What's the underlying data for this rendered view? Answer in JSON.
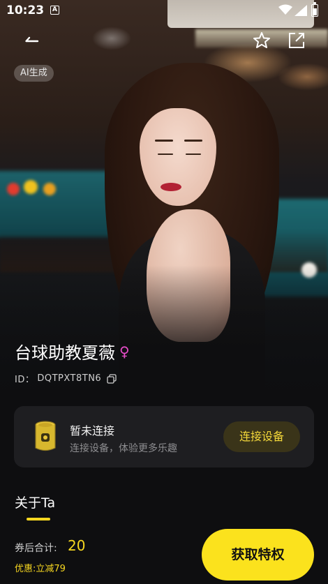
{
  "status_bar": {
    "time": "10:23",
    "app_icon_letter": "A"
  },
  "header": {
    "ai_badge": "AI生成"
  },
  "profile": {
    "name": "台球助教夏薇",
    "gender_symbol": "♀",
    "id_label": "ID：",
    "id_value": "DQTPXT8TN6"
  },
  "device": {
    "title": "暂未连接",
    "subtitle": "连接设备，体验更多乐趣",
    "button_label": "连接设备"
  },
  "about": {
    "tab_label": "关于Ta"
  },
  "purchase": {
    "price_label": "券后合计:",
    "price_value": "20",
    "discount_text": "优惠:立减79",
    "button_label": "获取特权"
  },
  "colors": {
    "accent": "#fbe21d",
    "accent_text": "#f7d720",
    "gender": "#e64cc8",
    "card": "#1e1e21",
    "background": "#0e0e10"
  },
  "icons": {
    "back": "arrow-left-icon",
    "favorite": "star-outline-icon",
    "share": "share-icon",
    "copy": "copy-icon",
    "device": "device-speaker-icon"
  }
}
